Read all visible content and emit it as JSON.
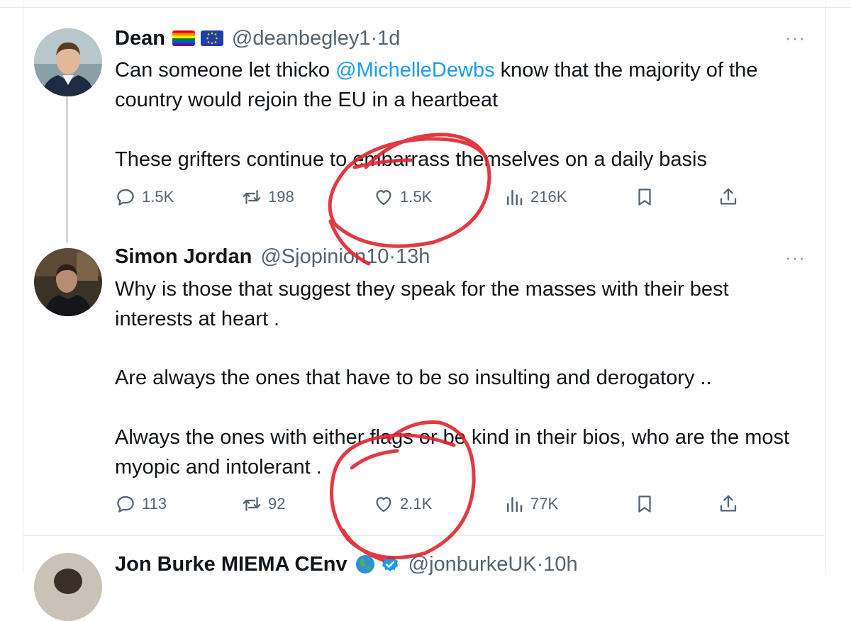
{
  "tweets": [
    {
      "name": "Dean",
      "flags": [
        "rainbow-flag",
        "eu-flag"
      ],
      "handle": "@deanbegley1",
      "time": "1d",
      "text_pre": "Can someone let  thicko ",
      "mention": "@MichelleDewbs",
      "text_post": " know that the majority of the country would rejoin the EU in a heartbeat",
      "paragraph2": "These grifters continue to embarrass themselves on a daily basis",
      "replies": "1.5K",
      "reposts": "198",
      "likes": "1.5K",
      "views": "216K"
    },
    {
      "name": "Simon Jordan",
      "handle": "@Sjopinion10",
      "time": "13h",
      "paragraph1": "Why is those that suggest they speak for the masses with their best interests at heart .",
      "paragraph2": "Are always the ones that have to be so insulting and derogatory ..",
      "paragraph3": "Always the ones with either flags or be kind in their bios, who are the most myopic and intolerant .",
      "replies": "113",
      "reposts": "92",
      "likes": "2.1K",
      "views": "77K"
    },
    {
      "name": "Jon Burke MIEMA CEnv",
      "badges": [
        "globe-emoji",
        "verified-badge"
      ],
      "handle": "@jonburkeUK",
      "time": "10h"
    }
  ],
  "ui": {
    "more_label": "···",
    "separator": " · "
  },
  "colors": {
    "accent": "#1d9bf0",
    "text": "#0f1419",
    "secondary": "#536471",
    "annotation": "#e0242e"
  }
}
